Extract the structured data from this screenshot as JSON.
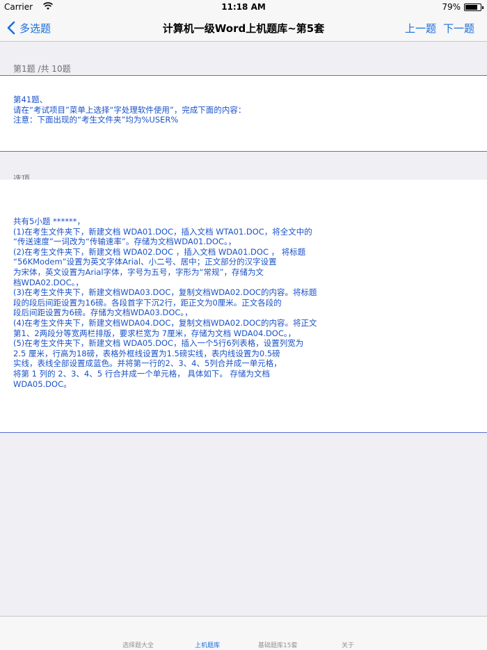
{
  "status_bar": {
    "carrier": "Carrier",
    "time": "11:18 AM",
    "battery": "79%"
  },
  "nav": {
    "back_label": "多选题",
    "title": "计算机一级Word上机题库~第5套",
    "prev_label": "上一题",
    "next_label": "下一题"
  },
  "question": {
    "counter": "第1题 /共 10题",
    "lines": [
      "第41题、",
      "请在“考试项目”菜单上选择“字处理软件使用”，完成下面的内容：",
      "注意：下面出现的“考生文件夹”均为%USER%"
    ]
  },
  "options": {
    "header": "选项",
    "lines": [
      "共有5小题 ******，",
      "(1)在考生文件夹下，新建文档 WDA01.DOC，插入文档 WTA01.DOC，将全文中的",
      "“传送速度”一词改为“传输速率”。存储为文档WDA01.DOC。，",
      "(2)在考生文件夹下，新建文档 WDA02.DOC ，插入文档 WDA01.DOC ，  将标题",
      "“56KModem”设置为英文字体Arial、小二号、居中；正文部分的汉字设置",
      "为宋体，英文设置为Arial字体，字号为五号，字形为“常规”，存储为文",
      "档WDA02.DOC。，",
      "(3)在考生文件夹下，新建文档WDA03.DOC，复制文档WDA02.DOC的内容。将标题",
      "段的段后间距设置为16磅。各段首字下沉2行，距正文为0厘米。正文各段的",
      "段后间距设置为6磅。存储为文档WDA03.DOC。，",
      "(4)在考生文件夹下，新建文档WDA04.DOC，复制文档WDA02.DOC的内容。将正文",
      "第1、2两段分等宽两栏排版，要求栏宽为 7厘米，存储为文档 WDA04.DOC。，",
      "(5)在考生文件夹下，新建文档 WDA05.DOC，插入一个5行6列表格，设置列宽为",
      "2.5 厘米，行高为18磅，表格外框线设置为1.5磅实线，表内线设置为0.5磅",
      "实线，表线全部设置成蓝色。并将第一行的2、3、4、5列合并成一单元格，",
      "将第 1 列的 2、3、4、5 行合并成一个单元格， 具体如下。 存储为文档",
      "WDA05.DOC。"
    ]
  },
  "tabs": [
    {
      "label": "选择题大全",
      "active": false
    },
    {
      "label": "上机题库",
      "active": true
    },
    {
      "label": "基础题库15套",
      "active": false
    },
    {
      "label": "关于",
      "active": false
    }
  ],
  "colors": {
    "accent": "#1a6ddb",
    "text_blue": "#1a52c8",
    "separator": "#5a6fd8"
  },
  "icons": {
    "wifi": "wifi-icon",
    "battery": "battery-icon",
    "back": "chevron-left-icon"
  }
}
